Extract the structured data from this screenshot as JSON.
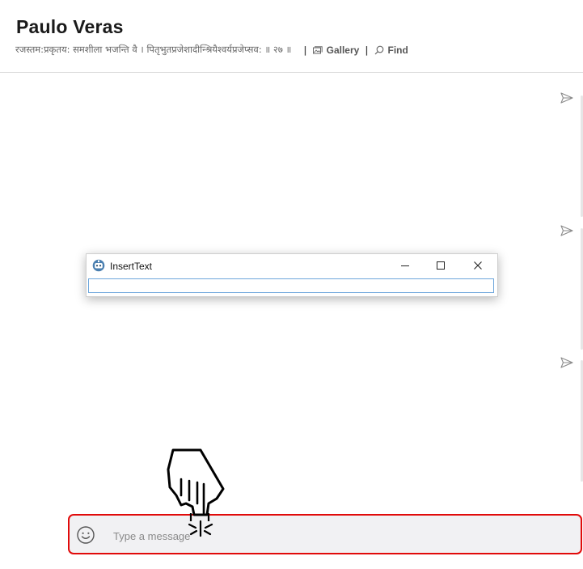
{
  "header": {
    "name": "Paulo Veras",
    "mood": "रजस्तम:प्रकृतय: समशीला भजन्ति वै । पितृभुतप्रजेशादीन्श्रियैश्वर्यप्रजेप्सव: ॥ २७ ॥",
    "gallery_label": "Gallery",
    "find_label": "Find",
    "separator": "|"
  },
  "dialog": {
    "title": "InsertText",
    "input_value": ""
  },
  "composer": {
    "placeholder": "Type a message"
  },
  "colors": {
    "highlight": "#e10a0a",
    "composer_bg": "#f1f1f3",
    "input_border": "#6fa7dc"
  },
  "icons": [
    "gallery-icon",
    "find-icon",
    "send-icon",
    "emoji-icon",
    "minimize-icon",
    "maximize-icon",
    "close-icon",
    "app-icon",
    "pointing-hand-icon"
  ]
}
